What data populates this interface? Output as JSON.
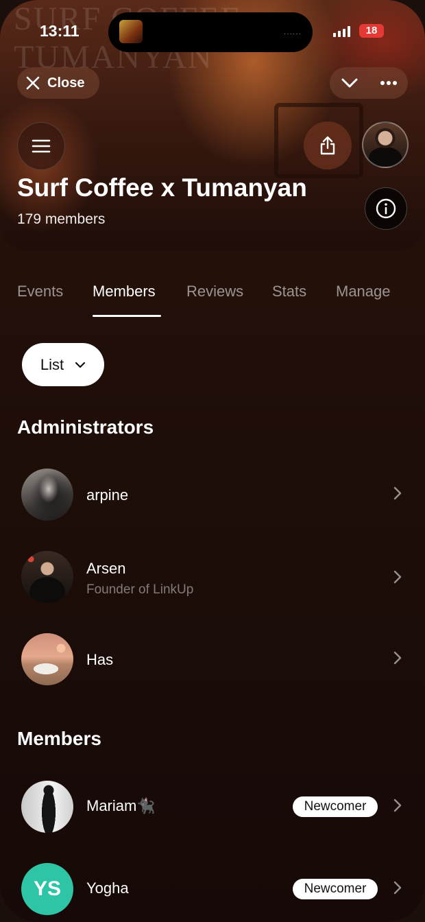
{
  "status_bar": {
    "time": "13:11",
    "battery": "18",
    "island_dots": "······"
  },
  "hero": {
    "background_text_line1": "SURF COFFEE",
    "background_text_line2": "TUMANYAN",
    "close_label": "Close",
    "title": "Surf Coffee x Tumanyan",
    "member_count": "179 members"
  },
  "tabs": [
    {
      "label": "Events",
      "active": false
    },
    {
      "label": "Members",
      "active": true
    },
    {
      "label": "Reviews",
      "active": false
    },
    {
      "label": "Stats",
      "active": false
    },
    {
      "label": "Manage",
      "active": false
    }
  ],
  "view_selector": {
    "value": "List"
  },
  "administrators": {
    "title": "Administrators",
    "items": [
      {
        "name": "arpine",
        "subtitle": ""
      },
      {
        "name": "Arsen",
        "subtitle": "Founder of LinkUp"
      },
      {
        "name": "Has",
        "subtitle": ""
      }
    ]
  },
  "members": {
    "title": "Members",
    "items": [
      {
        "name": "Mariam🐈‍⬛",
        "badge": "Newcomer",
        "initials": ""
      },
      {
        "name": "Yogha",
        "badge": "Newcomer",
        "initials": "YS"
      }
    ]
  },
  "colors": {
    "accent_avatar": "#2ec4a6",
    "battery": "#e53935"
  }
}
